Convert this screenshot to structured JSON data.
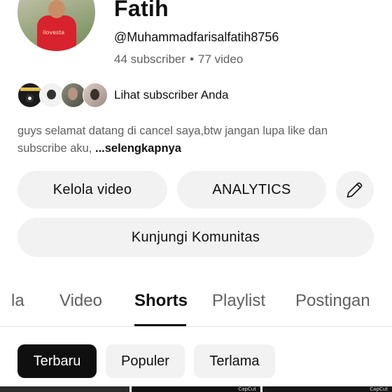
{
  "channel": {
    "name": "Fatih",
    "handle": "@Muhammadfarisalfatih8756",
    "subscribers": "44 subscriber",
    "separator": "•",
    "videos": "77 video",
    "avatar_jersey_text": "ilovesta",
    "see_subscribers": "Lihat subscriber Anda",
    "description": "guys selamat datang di cancel saya,btw jangan lupa like dan subscribe aku, ",
    "description_more": "...selengkapnya"
  },
  "actions": {
    "manage_videos": "Kelola video",
    "analytics": "ANALYTICS",
    "edit_icon": "pencil-icon",
    "visit_community": "Kunjungi Komunitas"
  },
  "tabs": [
    {
      "label": "la"
    },
    {
      "label": "Video"
    },
    {
      "label": "Shorts",
      "selected": true
    },
    {
      "label": "Playlist"
    },
    {
      "label": "Postingan"
    }
  ],
  "filters": [
    {
      "label": "Terbaru",
      "selected": true
    },
    {
      "label": "Populer"
    },
    {
      "label": "Terlama"
    }
  ],
  "thumbnails": [
    {
      "tag": ""
    },
    {
      "tag": "CapCut"
    },
    {
      "tag": "CapCut"
    }
  ],
  "colors": {
    "text_primary": "#0f0f0f",
    "text_secondary": "#606060",
    "chip_bg": "#f2f2f2",
    "chip_selected_bg": "#0f0f0f"
  }
}
